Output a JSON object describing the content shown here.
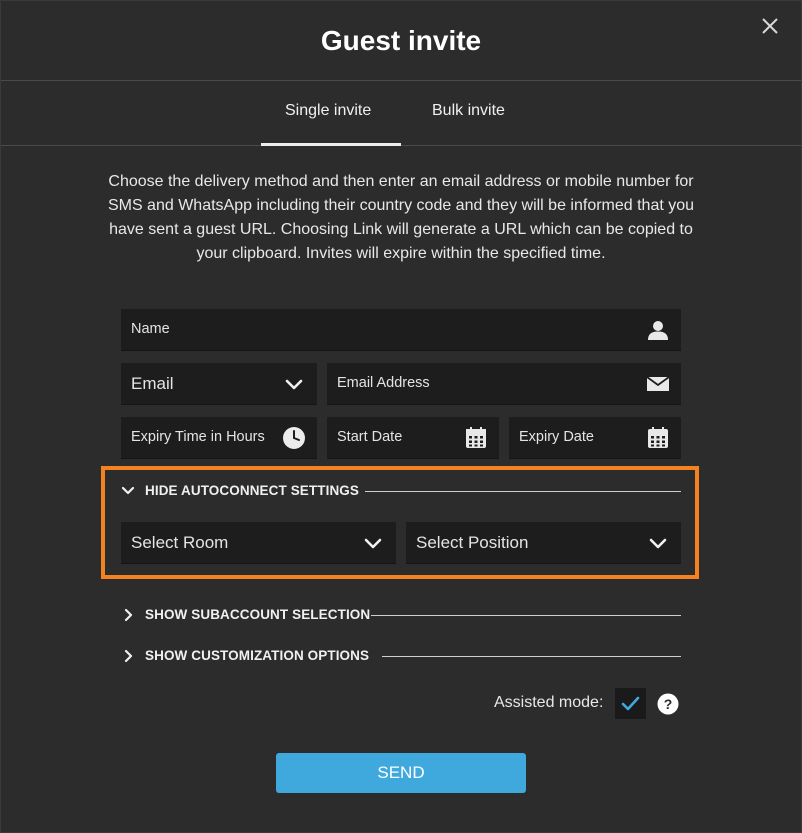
{
  "dialog": {
    "title": "Guest invite",
    "close_icon": "close-icon"
  },
  "tabs": [
    {
      "label": "Single invite",
      "active": true
    },
    {
      "label": "Bulk invite",
      "active": false
    }
  ],
  "description": "Choose the delivery method and then enter an email address or mobile number for SMS and WhatsApp including their country code and they will be informed that you have sent a guest URL. Choosing Link will generate a URL which can be copied to your clipboard. Invites will expire within the specified time.",
  "form": {
    "name_placeholder": "Name",
    "delivery_method": "Email",
    "email_placeholder": "Email Address",
    "expiry_hours_placeholder": "Expiry Time in Hours",
    "start_date_placeholder": "Start Date",
    "expiry_date_placeholder": "Expiry Date"
  },
  "autoconnect": {
    "toggle_label": "HIDE AUTOCONNECT SETTINGS",
    "room_select": "Select Room",
    "position_select": "Select Position"
  },
  "subaccount": {
    "toggle_label": "SHOW SUBACCOUNT SELECTION"
  },
  "customization": {
    "toggle_label": "SHOW CUSTOMIZATION OPTIONS"
  },
  "assisted": {
    "label": "Assisted mode:",
    "checked": true
  },
  "send_label": "SEND",
  "colors": {
    "accent": "#3fa9de",
    "highlight": "#f58220",
    "background": "#2c2c2c",
    "field": "#1d1d1d"
  }
}
